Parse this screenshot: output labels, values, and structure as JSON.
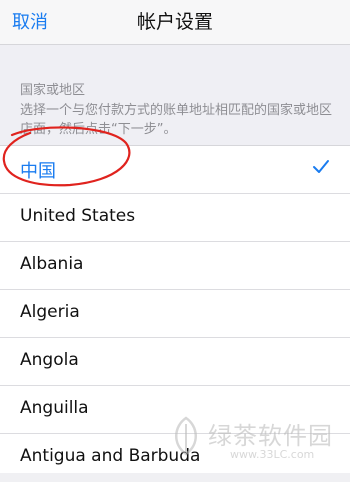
{
  "navbar": {
    "cancel_label": "取消",
    "title": "帐户设置"
  },
  "section": {
    "header": "国家或地区",
    "description": "选择一个与您付款方式的账单地址相匹配的国家或地区店面，然后点击“下一步”。"
  },
  "countries": [
    {
      "label": "中国",
      "selected": true
    },
    {
      "label": "United States",
      "selected": false
    },
    {
      "label": "Albania",
      "selected": false
    },
    {
      "label": "Algeria",
      "selected": false
    },
    {
      "label": "Angola",
      "selected": false
    },
    {
      "label": "Anguilla",
      "selected": false
    },
    {
      "label": "Antigua and Barbuda",
      "selected": false
    }
  ],
  "watermark": {
    "title": "绿茶软件园",
    "url": "www.33LC.com"
  },
  "colors": {
    "accent": "#1a7cf0",
    "annotation": "#e0231e",
    "background": "#efeff4"
  }
}
